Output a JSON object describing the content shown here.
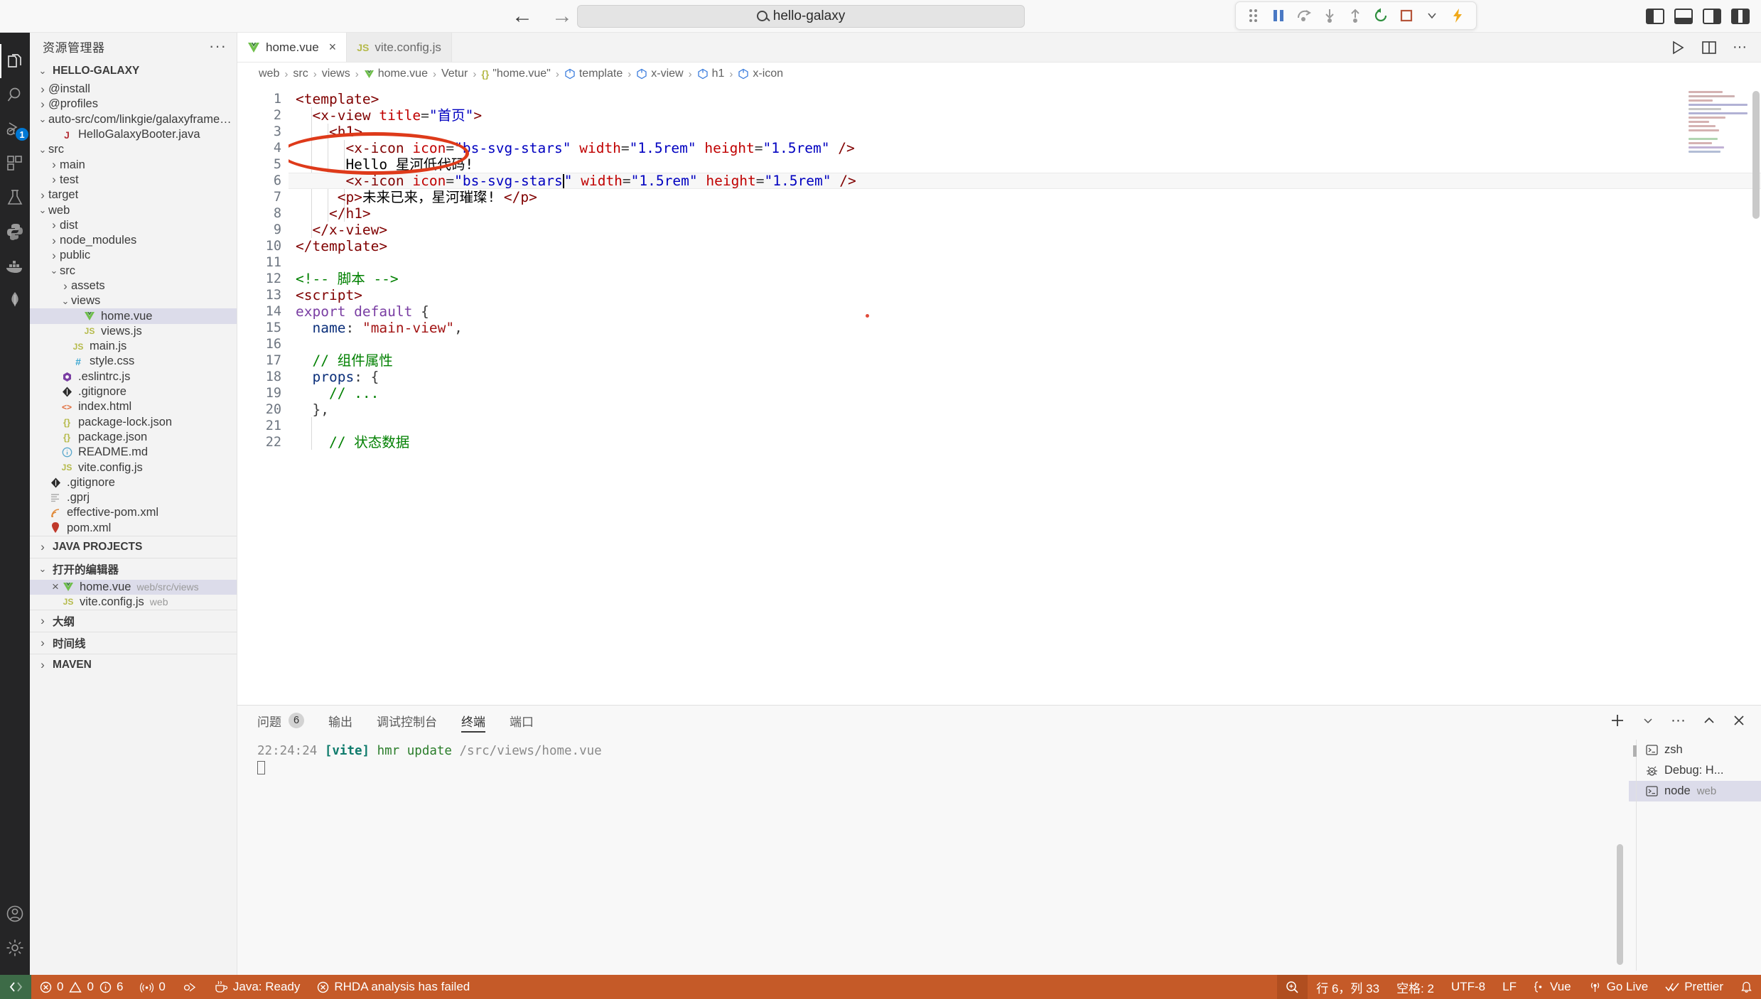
{
  "titlebar": {
    "back_label": "←",
    "forward_label": "→",
    "search_value": "hello-galaxy",
    "search_icon": "search-icon",
    "debug_buttons": [
      "grip",
      "pause",
      "step-over",
      "step-into",
      "step-out",
      "restart",
      "stop",
      "chevron-down",
      "lightning"
    ]
  },
  "activitybar": {
    "items": [
      {
        "name": "explorer",
        "icon": "files-icon",
        "badge": ""
      },
      {
        "name": "search",
        "icon": "search-icon",
        "badge": ""
      },
      {
        "name": "run-and-debug",
        "icon": "debug-icon",
        "badge": "1"
      },
      {
        "name": "extensions",
        "icon": "extensions-icon",
        "badge": ""
      },
      {
        "name": "testing",
        "icon": "beaker-icon",
        "badge": ""
      },
      {
        "name": "python",
        "icon": "python-icon",
        "badge": ""
      },
      {
        "name": "docker",
        "icon": "docker-icon",
        "badge": ""
      },
      {
        "name": "mongodb",
        "icon": "leaf-icon",
        "badge": ""
      }
    ],
    "bottom": [
      {
        "name": "accounts",
        "icon": "account-icon"
      },
      {
        "name": "settings",
        "icon": "gear-icon"
      }
    ]
  },
  "sidebar": {
    "title": "资源管理器",
    "more_label": "···",
    "root_section": "HELLO-GALAXY",
    "tree": [
      {
        "label": "@install",
        "icon": "folder",
        "depth": 1,
        "state": "collapsed"
      },
      {
        "label": "@profiles",
        "icon": "folder",
        "depth": 1,
        "state": "collapsed"
      },
      {
        "label": "auto-src/com/linkgie/galaxyframew...",
        "icon": "folder",
        "depth": 1,
        "state": "expanded"
      },
      {
        "label": "HelloGalaxyBooter.java",
        "icon": "java",
        "depth": 2,
        "state": "file"
      },
      {
        "label": "src",
        "icon": "folder",
        "depth": 1,
        "state": "expanded"
      },
      {
        "label": "main",
        "icon": "folder",
        "depth": 2,
        "state": "collapsed"
      },
      {
        "label": "test",
        "icon": "folder",
        "depth": 2,
        "state": "collapsed"
      },
      {
        "label": "target",
        "icon": "folder",
        "depth": 1,
        "state": "collapsed"
      },
      {
        "label": "web",
        "icon": "folder",
        "depth": 1,
        "state": "expanded"
      },
      {
        "label": "dist",
        "icon": "folder",
        "depth": 2,
        "state": "collapsed"
      },
      {
        "label": "node_modules",
        "icon": "folder",
        "depth": 2,
        "state": "collapsed"
      },
      {
        "label": "public",
        "icon": "folder",
        "depth": 2,
        "state": "collapsed"
      },
      {
        "label": "src",
        "icon": "folder",
        "depth": 2,
        "state": "expanded"
      },
      {
        "label": "assets",
        "icon": "folder",
        "depth": 3,
        "state": "collapsed"
      },
      {
        "label": "views",
        "icon": "folder",
        "depth": 3,
        "state": "expanded"
      },
      {
        "label": "home.vue",
        "icon": "vue",
        "depth": 4,
        "state": "file",
        "selected": true
      },
      {
        "label": "views.js",
        "icon": "js",
        "depth": 4,
        "state": "file"
      },
      {
        "label": "main.js",
        "icon": "js",
        "depth": 3,
        "state": "file"
      },
      {
        "label": "style.css",
        "icon": "css",
        "depth": 3,
        "state": "file"
      },
      {
        "label": ".eslintrc.js",
        "icon": "eslint",
        "depth": 2,
        "state": "file"
      },
      {
        "label": ".gitignore",
        "icon": "git",
        "depth": 2,
        "state": "file"
      },
      {
        "label": "index.html",
        "icon": "html",
        "depth": 2,
        "state": "file"
      },
      {
        "label": "package-lock.json",
        "icon": "json",
        "depth": 2,
        "state": "file"
      },
      {
        "label": "package.json",
        "icon": "json",
        "depth": 2,
        "state": "file"
      },
      {
        "label": "README.md",
        "icon": "md",
        "depth": 2,
        "state": "file"
      },
      {
        "label": "vite.config.js",
        "icon": "js",
        "depth": 2,
        "state": "file"
      },
      {
        "label": ".gitignore",
        "icon": "git",
        "depth": 1,
        "state": "file"
      },
      {
        "label": ".gprj",
        "icon": "list",
        "depth": 1,
        "state": "file"
      },
      {
        "label": "effective-pom.xml",
        "icon": "xml",
        "depth": 1,
        "state": "file"
      },
      {
        "label": "pom.xml",
        "icon": "maven",
        "depth": 1,
        "state": "file"
      }
    ],
    "sections": [
      {
        "label": "JAVA PROJECTS",
        "state": "collapsed"
      },
      {
        "label": "打开的编辑器",
        "state": "expanded"
      },
      {
        "label": "大纲",
        "state": "collapsed"
      },
      {
        "label": "时间线",
        "state": "collapsed"
      },
      {
        "label": "MAVEN",
        "state": "collapsed"
      }
    ],
    "open_editors": [
      {
        "label": "home.vue",
        "sub": "web/src/views",
        "icon": "vue",
        "selected": true,
        "close": "×"
      },
      {
        "label": "vite.config.js",
        "sub": "web",
        "icon": "js",
        "selected": false,
        "close": ""
      }
    ]
  },
  "tabs": [
    {
      "label": "home.vue",
      "icon": "vue-icon",
      "active": true,
      "close": "×"
    },
    {
      "label": "vite.config.js",
      "icon": "js-icon",
      "active": false,
      "close": ""
    }
  ],
  "tab_actions": [
    "run-icon",
    "split-editor-icon",
    "more-icon"
  ],
  "breadcrumbs": [
    {
      "label": "web",
      "icon": ""
    },
    {
      "label": "src",
      "icon": ""
    },
    {
      "label": "views",
      "icon": ""
    },
    {
      "label": "home.vue",
      "icon": "vue-icon"
    },
    {
      "label": "Vetur",
      "icon": ""
    },
    {
      "label": "\"home.vue\"",
      "icon": "braces-icon"
    },
    {
      "label": "template",
      "icon": "symbol-icon"
    },
    {
      "label": "x-view",
      "icon": "symbol-icon"
    },
    {
      "label": "h1",
      "icon": "symbol-icon"
    },
    {
      "label": "x-icon",
      "icon": "symbol-icon"
    }
  ],
  "editor": {
    "line_numbers": [
      "1",
      "2",
      "3",
      "4",
      "5",
      "6",
      "7",
      "8",
      "9",
      "10",
      "11",
      "12",
      "13",
      "14",
      "15",
      "16",
      "17",
      "18",
      "19",
      "20",
      "21",
      "22"
    ],
    "current_line": 6,
    "annotation": "red-ellipse-around-icon-attribute",
    "lines": [
      "<template>",
      "  <x-view title=\"首页\">",
      "    <h1>",
      "      <x-icon icon=\"bs-svg-stars\" width=\"1.5rem\" height=\"1.5rem\" />",
      "      Hello 星河低代码!",
      "      <x-icon icon=\"bs-svg-stars\" width=\"1.5rem\" height=\"1.5rem\" />",
      "      <p>未来已来，星河璀璨! </p>",
      "    </h1>",
      "  </x-view>",
      "</template>",
      "",
      "<!-- 脚本 -->",
      "<script>",
      "export default {",
      "  name: \"main-view\",",
      "",
      "  // 组件属性",
      "  props: {",
      "    // ...",
      "  },",
      "",
      "    // 状态数据"
    ]
  },
  "panel": {
    "tabs": [
      {
        "label": "问题",
        "badge": "6",
        "active": false
      },
      {
        "label": "输出",
        "badge": "",
        "active": false
      },
      {
        "label": "调试控制台",
        "badge": "",
        "active": false
      },
      {
        "label": "终端",
        "badge": "",
        "active": true
      },
      {
        "label": "端口",
        "badge": "",
        "active": false
      }
    ],
    "actions": [
      "add-terminal-icon",
      "chevron-down-icon",
      "more-icon",
      "chevron-up-icon",
      "close-icon"
    ],
    "terminal": {
      "timestamp": "22:24:24",
      "tag": "[vite]",
      "message": "hmr update",
      "path": "/src/views/home.vue"
    },
    "terminal_list": [
      {
        "label": "zsh",
        "sub": "",
        "icon": "terminal-icon",
        "selected": false
      },
      {
        "label": "Debug: H...",
        "sub": "",
        "icon": "bug-icon",
        "selected": false
      },
      {
        "label": "node",
        "sub": "web",
        "icon": "terminal-icon",
        "selected": true
      }
    ]
  },
  "statusbar": {
    "remote_icon": "remote-icon",
    "left": [
      {
        "icon": "error-icon",
        "label": "0"
      },
      {
        "icon": "warning-icon",
        "label": "0"
      },
      {
        "icon": "info-icon",
        "label": "6"
      },
      {
        "icon": "radio-tower-icon",
        "label": "0"
      },
      {
        "icon": "debug-alt-icon",
        "label": ""
      },
      {
        "icon": "coffee-icon",
        "label": "Java: Ready"
      },
      {
        "icon": "error-icon",
        "label": "RHDA analysis has failed"
      }
    ],
    "right": [
      {
        "icon": "zoom-icon",
        "label": "",
        "highlight": true
      },
      {
        "icon": "",
        "label": "行 6，列 33"
      },
      {
        "icon": "",
        "label": "空格: 2"
      },
      {
        "icon": "",
        "label": "UTF-8"
      },
      {
        "icon": "",
        "label": "LF"
      },
      {
        "icon": "vue-lang-icon",
        "label": "Vue"
      },
      {
        "icon": "broadcast-icon",
        "label": "Go Live"
      },
      {
        "icon": "check-icon",
        "label": "Prettier"
      },
      {
        "icon": "bell-icon",
        "label": ""
      }
    ]
  },
  "colors": {
    "statusbar_bg": "#c55a28",
    "remote_bg": "#3d6b47",
    "accent_blue": "#0078d4",
    "annotation_red": "#de3a1a",
    "selection": "#dcdcea"
  }
}
